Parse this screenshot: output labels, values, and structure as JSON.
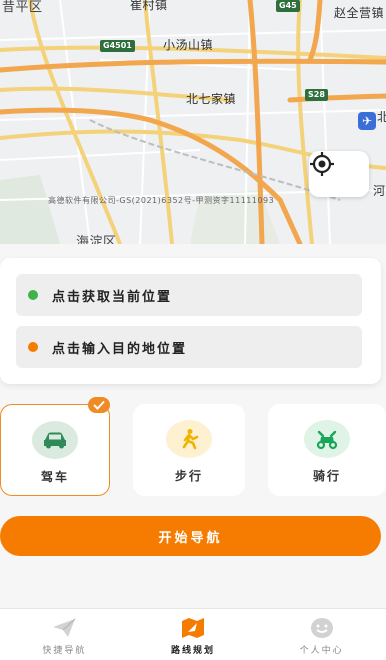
{
  "map": {
    "labels": {
      "top_left": "昔平区",
      "top_center": "崔村镇",
      "top_right": "赵全营镇",
      "xiaotangshan": "小汤山镇",
      "beiqijia": "北七家镇",
      "haidian": "海淀区",
      "right_edge_1": "北",
      "right_edge_2": "河"
    },
    "shields": {
      "g4501": "G4501",
      "s28": "S28",
      "g45": "G45"
    },
    "copyright": "高德软件有限公司-GS(2021)6352号-甲测资字11111093",
    "locate_icon": "locate-crosshair-icon",
    "airport_icon": "airplane-icon"
  },
  "location": {
    "current": "点击获取当前位置",
    "destination": "点击输入目的地位置",
    "current_dot_color": "#3cb44a",
    "destination_dot_color": "#f57c00"
  },
  "modes": [
    {
      "label": "驾车",
      "icon": "car-icon",
      "selected": true
    },
    {
      "label": "步行",
      "icon": "walking-person-icon",
      "selected": false
    },
    {
      "label": "骑行",
      "icon": "scooter-icon",
      "selected": false
    }
  ],
  "start_button": "开始导航",
  "nav": [
    {
      "label": "快捷导航",
      "icon": "paper-plane-icon",
      "active": false
    },
    {
      "label": "路线规划",
      "icon": "route-map-icon",
      "active": true
    },
    {
      "label": "个人中心",
      "icon": "smiley-face-icon",
      "active": false
    }
  ],
  "colors": {
    "accent": "#f57c00",
    "selected_border": "#f08a24",
    "card_bg": "#ffffff",
    "row_bg": "#eeeeee"
  }
}
